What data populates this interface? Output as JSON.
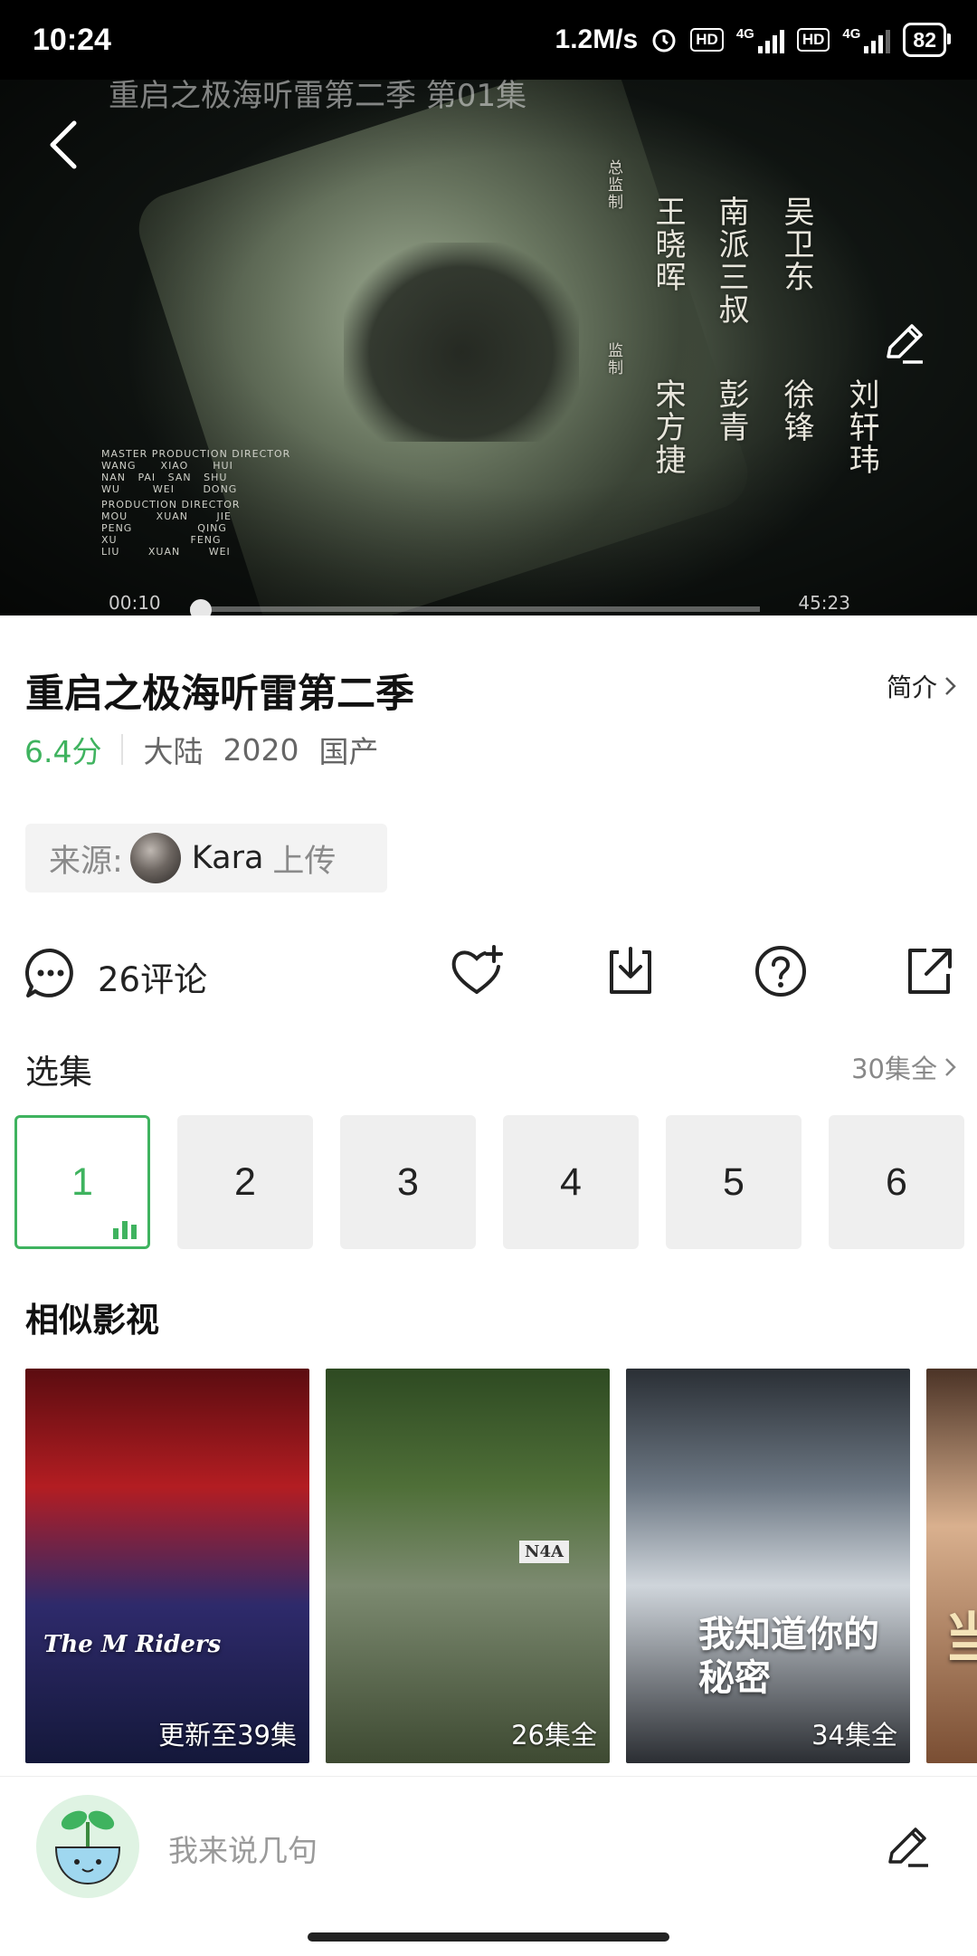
{
  "status_bar": {
    "time": "10:24",
    "net_speed": "1.2M/s",
    "hd1": "HD",
    "sig1": "4G",
    "hd2": "HD",
    "sig2": "4G",
    "battery": "82"
  },
  "video": {
    "ghost_title": "重启之极海听雷第二季 第01集",
    "credits": {
      "col_small_1": "总监制",
      "col_small_2": "监制",
      "col1": "王晓晖",
      "col2": "南派三叔",
      "col3": "吴卫东",
      "col4": "宋方捷",
      "col5": "彭青",
      "col6": "徐锋",
      "col7": "刘轩玮",
      "en": [
        "MASTER PRODUCTION DIRECTOR",
        "WANG      XIAO      HUI",
        "NAN   PAI   SAN   SHU",
        "WU        WEI       DONG",
        "PRODUCTION DIRECTOR",
        "MOU       XUAN       JIE",
        "PENG                QING",
        "XU                  FENG",
        "LIU       XUAN       WEI"
      ]
    },
    "time_current": "00:10",
    "time_total": "45:23",
    "progress_fraction": 0.002
  },
  "info": {
    "title": "重启之极海听雷第二季",
    "intro_label": "简介",
    "score": "6.4分",
    "region": "大陆",
    "year": "2020",
    "origin": "国产",
    "source_prefix": "来源:",
    "uploader": "Kara",
    "upload_suffix": "上传"
  },
  "actions": {
    "comment_count": "26评论",
    "icons": [
      "favorite-add-icon",
      "download-icon",
      "help-icon",
      "share-icon"
    ]
  },
  "episodes": {
    "heading": "选集",
    "total": "30集全",
    "items": [
      "1",
      "2",
      "3",
      "4",
      "5",
      "6"
    ],
    "active": "1"
  },
  "similar": {
    "heading": "相似影视",
    "items": [
      {
        "caption": "更新至39集",
        "poster_text": "The M Riders"
      },
      {
        "caption": "26集全",
        "poster_text": "N4A"
      },
      {
        "caption": "34集全",
        "poster_text": "我知道你的秘密"
      },
      {
        "caption": "",
        "poster_text": "当"
      }
    ]
  },
  "bottom": {
    "placeholder": "我来说几句"
  },
  "colors": {
    "accent_green": "#3fb35f"
  }
}
